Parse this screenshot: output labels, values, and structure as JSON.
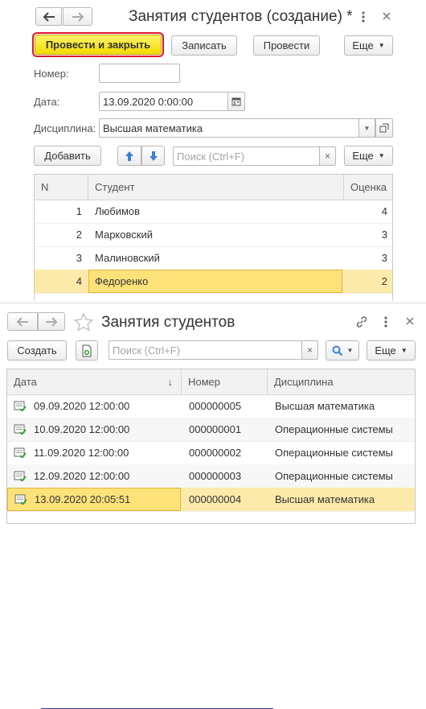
{
  "form": {
    "title": "Занятия студентов (создание) *",
    "toolbar": {
      "post_close": "Провести и закрыть",
      "save": "Записать",
      "post": "Провести",
      "more": "Еще"
    },
    "fields": {
      "number_label": "Номер:",
      "number_value": "",
      "date_label": "Дата:",
      "date_value": "13.09.2020  0:00:00",
      "discipline_label": "Дисциплина:",
      "discipline_value": "Высшая математика"
    },
    "table_toolbar": {
      "add": "Добавить",
      "search_placeholder": "Поиск (Ctrl+F)",
      "more": "Еще"
    },
    "table": {
      "headers": [
        "N",
        "Студент",
        "Оценка"
      ],
      "rows": [
        {
          "n": "1",
          "student": "Любимов",
          "grade": "4"
        },
        {
          "n": "2",
          "student": "Марковский",
          "grade": "3"
        },
        {
          "n": "3",
          "student": "Малиновский",
          "grade": "3"
        },
        {
          "n": "4",
          "student": "Федоренко",
          "grade": "2"
        }
      ]
    }
  },
  "list": {
    "title": "Занятия студентов",
    "toolbar": {
      "create": "Создать",
      "search_placeholder": "Поиск (Ctrl+F)",
      "more": "Еще"
    },
    "table": {
      "headers": [
        "Дата",
        "Номер",
        "Дисциплина"
      ],
      "rows": [
        {
          "date": "09.09.2020 12:00:00",
          "number": "000000005",
          "discipline": "Высшая математика"
        },
        {
          "date": "10.09.2020 12:00:00",
          "number": "000000001",
          "discipline": "Операционные системы"
        },
        {
          "date": "11.09.2020 12:00:00",
          "number": "000000002",
          "discipline": "Операционные системы"
        },
        {
          "date": "12.09.2020 12:00:00",
          "number": "000000003",
          "discipline": "Операционные системы"
        },
        {
          "date": "13.09.2020 20:05:51",
          "number": "000000004",
          "discipline": "Высшая математика"
        }
      ]
    }
  },
  "colors": {
    "default_button": "#f3dc00",
    "highlight_outline": "#e0142d",
    "selected_row": "#fbeaa9",
    "arrow_blue": "#3b82d6",
    "doc_icon_green": "#3aa23a"
  }
}
